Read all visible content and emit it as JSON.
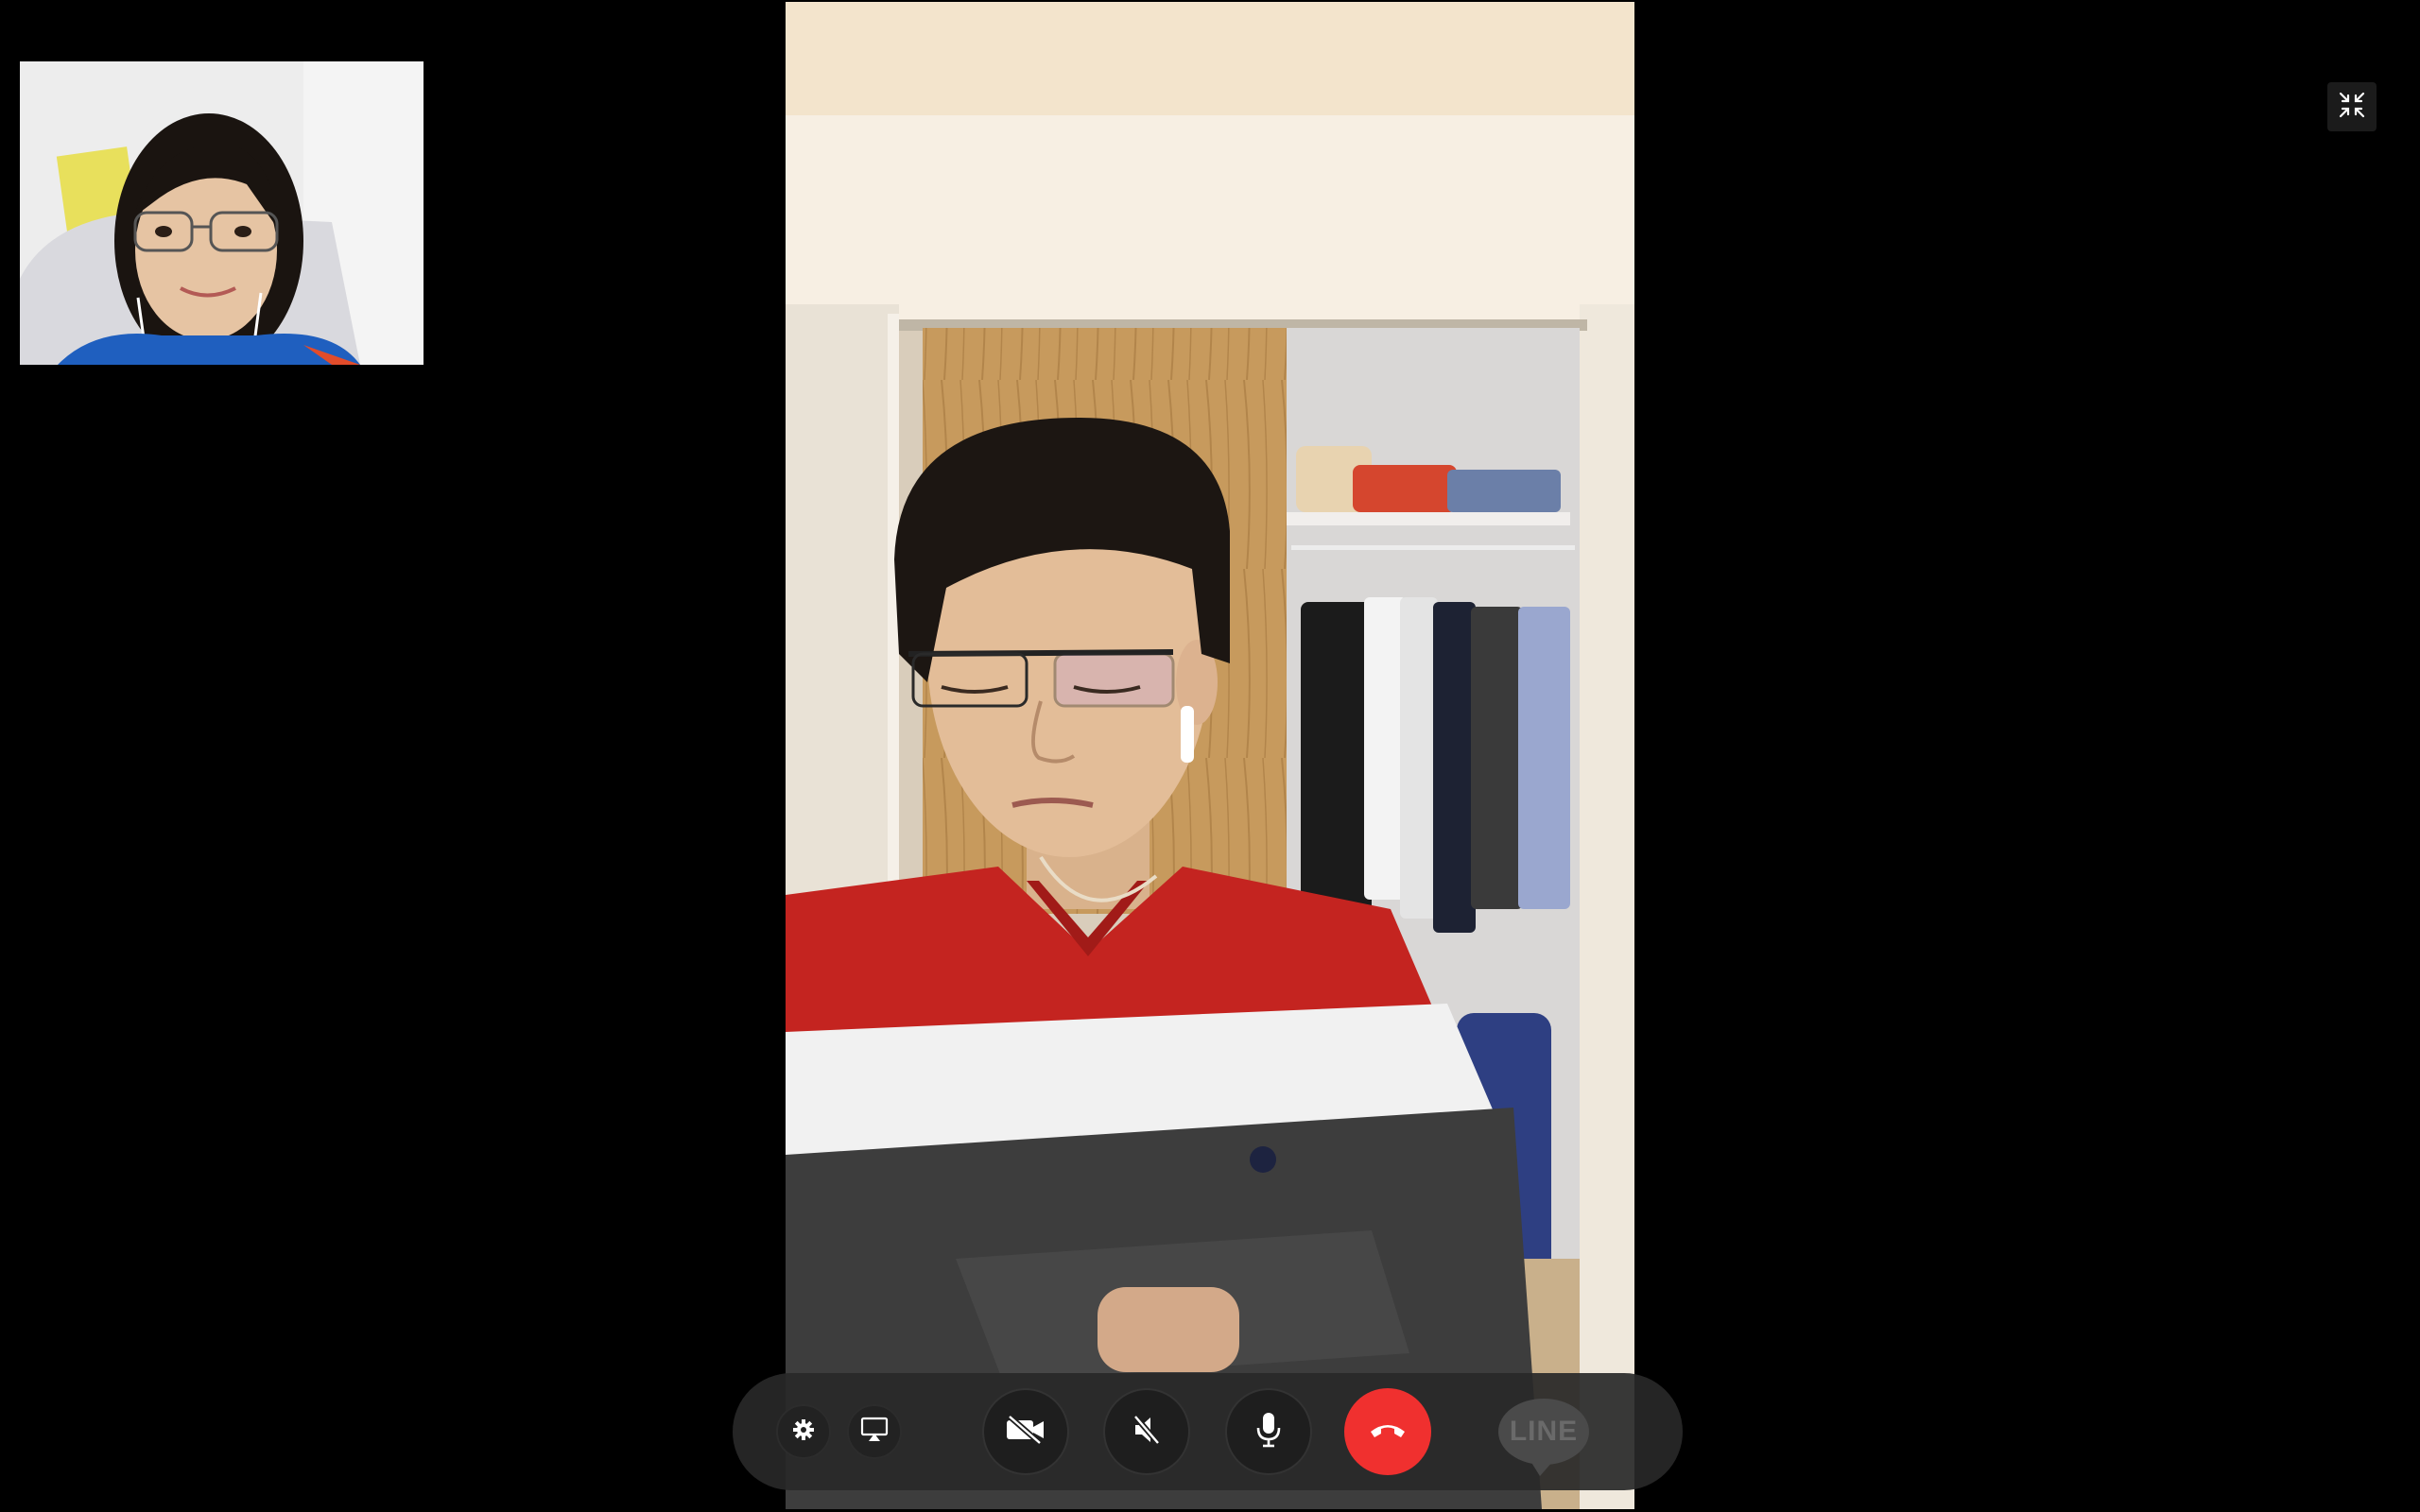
{
  "call": {
    "remote_video": {
      "description_name": "remote-participant-video"
    },
    "self_preview": {
      "description_name": "self-camera-preview"
    }
  },
  "controls": {
    "exit_fullscreen": {
      "icon": "exit-fullscreen-icon"
    },
    "settings": {
      "icon": "gear-icon"
    },
    "screen_share": {
      "icon": "screen-share-icon"
    },
    "camera": {
      "icon": "video-camera-off-icon",
      "state": "off"
    },
    "speaker": {
      "icon": "speaker-muted-icon",
      "state": "muted"
    },
    "microphone": {
      "icon": "microphone-icon",
      "state": "on"
    },
    "end_call": {
      "icon": "phone-hangup-icon"
    },
    "line_app": {
      "label": "LINE"
    }
  },
  "colors": {
    "background": "#000000",
    "control_bar": "#282828",
    "end_call": "#f0302f",
    "icon": "#ffffff"
  }
}
